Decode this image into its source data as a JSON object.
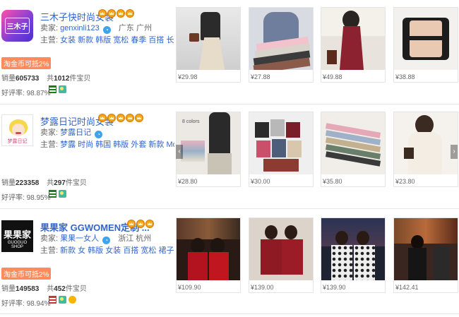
{
  "shops": [
    {
      "logo_text": "三木子",
      "name": "三木子快时尚女装",
      "seller_label": "卖家:",
      "seller_nick": "genxinli123",
      "location": "广东 广州",
      "main_label": "主营:",
      "main_keywords": "女装 新款 韩版 宽松 春季 百搭 长袖 学生",
      "coin_badge": "淘金币可抵2%",
      "sales_label": "销量",
      "sales": "605733",
      "count_prefix": "共",
      "count": "1012",
      "count_suffix": "件宝贝",
      "rating_label": "好评率:",
      "rating": "98.87%",
      "prices": [
        "¥29.98",
        "¥27.88",
        "¥49.88",
        "¥38.88"
      ]
    },
    {
      "logo_text": "梦露日记",
      "name": "梦露日记时尚女装",
      "seller_label": "卖家:",
      "seller_nick": "梦露日记",
      "location": "",
      "main_label": "主营:",
      "main_keywords": "梦露 时尚 韩国 韩版 外套 新款 Monroe 修...",
      "coin_badge": "",
      "sales_label": "销量",
      "sales": "223358",
      "count_prefix": "共",
      "count": "297",
      "count_suffix": "件宝贝",
      "rating_label": "好评率:",
      "rating": "98.95%",
      "prices": [
        "¥28.80",
        "¥30.00",
        "¥35.80",
        "¥23.80"
      ],
      "photo_caption": "8 colors"
    },
    {
      "logo_text": "果果家",
      "logo_subtext": "GUOGUO SHOP",
      "name": "果果家 GGWOMEN定制 ...",
      "seller_label": "卖家:",
      "seller_nick": "果果一女人",
      "location": "浙江 杭州",
      "main_label": "主营:",
      "main_keywords": "新款 女 韩版 女装 百搭 宽松 裙子 外套 冬...",
      "coin_badge": "淘金币可抵2%",
      "sales_label": "销量",
      "sales": "149583",
      "count_prefix": "共",
      "count": "452",
      "count_suffix": "件宝贝",
      "rating_label": "好评率:",
      "rating": "98.94%",
      "prices": [
        "¥109.90",
        "¥139.00",
        "¥139.90",
        "¥142.41"
      ]
    }
  ],
  "icons": {
    "crown": "crown-icon",
    "wangwang": "wangwang-icon",
    "arrow_left": "‹",
    "arrow_right": "›"
  },
  "colors": {
    "link": "#3366cc",
    "coin_badge_bg": "#ff8a5b",
    "crown": "#f3a417"
  }
}
